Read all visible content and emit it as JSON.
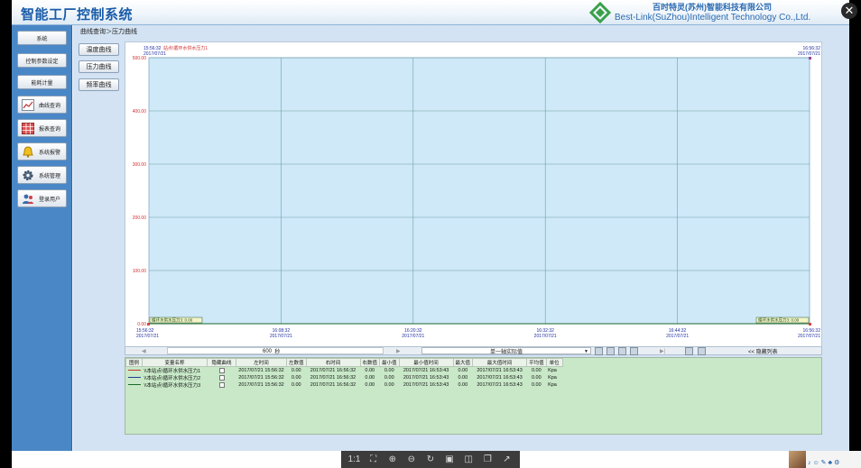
{
  "app": {
    "title": "智能工厂控制系统",
    "company_cn": "百时特灵(苏州)智能科技有限公司",
    "company_en": "Best-Link(SuZhou)Intelligent Technology Co.,Ltd."
  },
  "sidebar": {
    "items": [
      {
        "label": "系统"
      },
      {
        "label": "控制参数设定"
      },
      {
        "label": "能耗计量"
      },
      {
        "label": "曲线查询",
        "icon": "line-chart-icon"
      },
      {
        "label": "报表查询",
        "icon": "table-grid-icon"
      },
      {
        "label": "系统报警",
        "icon": "alarm-bell-icon"
      },
      {
        "label": "系统管理",
        "icon": "gear-icon"
      },
      {
        "label": "登录用户",
        "icon": "users-icon"
      }
    ]
  },
  "breadcrumb": "曲线查询＞压力曲线",
  "curve_buttons": [
    "温度曲线",
    "压力曲线",
    "频率曲线"
  ],
  "chart_data": {
    "type": "line",
    "top_left_time": "15:56:32",
    "top_left_date": "2017/07/21",
    "top_left_title": "站点\\循环水供水压力1",
    "top_right_time": "16:56:32",
    "top_right_date": "2017/07/21",
    "y_ticks": [
      "500.00",
      "400.00",
      "300.00",
      "200.00",
      "100.00",
      "0.00"
    ],
    "y_values": [
      500,
      400,
      300,
      200,
      100,
      0
    ],
    "ylim": [
      0,
      500
    ],
    "x_ticks": [
      {
        "time": "15:56:32",
        "date": "2017/07/21"
      },
      {
        "time": "16:08:32",
        "date": "2017/07/21"
      },
      {
        "time": "16:20:32",
        "date": "2017/07/21"
      },
      {
        "time": "16:32:32",
        "date": "2017/07/21"
      },
      {
        "time": "16:44:32",
        "date": "2017/07/21"
      },
      {
        "time": "16:56:32",
        "date": "2017/07/21"
      }
    ],
    "left_cursor_label": "循环水供水压力3: 0.00",
    "right_cursor_label": "循环水供水压力3: 0.00",
    "series": [
      {
        "name": "\\\\本站点\\循环水供水压力1",
        "color": "#c0392b",
        "values": [
          0,
          0
        ]
      },
      {
        "name": "\\\\本站点\\循环水供水压力2",
        "color": "#1f3f9a",
        "values": [
          0,
          0
        ]
      },
      {
        "name": "\\\\本站点\\循环水供水压力3",
        "color": "#1a6a2a",
        "values": [
          0,
          0
        ]
      }
    ],
    "grid": true,
    "background": "#cfe9f9"
  },
  "toolbar": {
    "span_value": "600",
    "span_unit": "秒",
    "mode_select": "单一轴实际值",
    "data_list_label": "<< 隐藏列表"
  },
  "table": {
    "headers": [
      "图例",
      "变量名称",
      "隐藏曲线",
      "左时间",
      "左数值",
      "右时间",
      "右数值",
      "最小值",
      "最小值时间",
      "最大值",
      "最大值时间",
      "平均值",
      "单位"
    ],
    "rows": [
      {
        "color": "#c0392b",
        "name": "\\\\本站点\\循环水供水压力1",
        "left_time": "2017/07/21 15:56:32",
        "left_value": "0.00",
        "right_time": "2017/07/21 16:56:32",
        "right_value": "0.00",
        "min": "0.00",
        "min_time": "2017/07/21 16:53:43",
        "max": "0.00",
        "max_time": "2017/07/21 16:53:43",
        "avg": "0.00",
        "unit": "Kpa"
      },
      {
        "color": "#1f3f9a",
        "name": "\\\\本站点\\循环水供水压力2",
        "left_time": "2017/07/21 15:56:32",
        "left_value": "0.00",
        "right_time": "2017/07/21 16:56:32",
        "right_value": "0.00",
        "min": "0.00",
        "min_time": "2017/07/21 16:53:43",
        "max": "0.00",
        "max_time": "2017/07/21 16:53:43",
        "avg": "0.00",
        "unit": "Kpa"
      },
      {
        "color": "#1a6a2a",
        "name": "\\\\本站点\\循环水供水压力3",
        "left_time": "2017/07/21 15:56:32",
        "left_value": "0.00",
        "right_time": "2017/07/21 16:56:32",
        "right_value": "0.00",
        "min": "0.00",
        "min_time": "2017/07/21 16:53:43",
        "max": "0.00",
        "max_time": "2017/07/21 16:53:43",
        "avg": "0.00",
        "unit": "Kpa"
      }
    ]
  },
  "viewer": {
    "actual_size_label": "1:1"
  }
}
